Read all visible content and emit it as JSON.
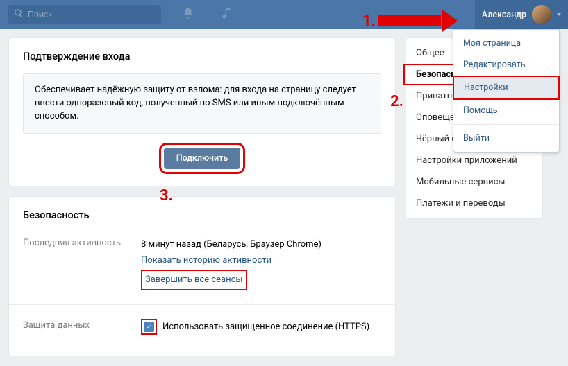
{
  "topbar": {
    "search_placeholder": "Поиск",
    "username": "Александр"
  },
  "annot": {
    "one": "1.",
    "two": "2.",
    "three": "3."
  },
  "dropdown": {
    "items": [
      "Моя страница",
      "Редактировать",
      "Настройки",
      "Помощь",
      "Выйти"
    ]
  },
  "confirm_card": {
    "title": "Подтверждение входа",
    "desc": "Обеспечивает надёжную защиту от взлома: для входа на страницу следует ввести одноразовый код, полученный по SMS или иным подключённым способом.",
    "button": "Подключить"
  },
  "security_card": {
    "title": "Безопасность",
    "activity_label": "Последняя активность",
    "activity_value": "8 минут назад (Беларусь, Браузер Chrome)",
    "show_history": "Показать историю активности",
    "end_sessions": "Завершить все сеансы",
    "data_protect_label": "Защита данных",
    "https_label": "Использовать защищенное соединение (HTTPS)"
  },
  "sidebar": {
    "items": [
      "Общее",
      "Безопасность",
      "Приватность",
      "Оповещения",
      "Чёрный список",
      "Настройки приложений",
      "Мобильные сервисы",
      "Платежи и переводы"
    ]
  }
}
